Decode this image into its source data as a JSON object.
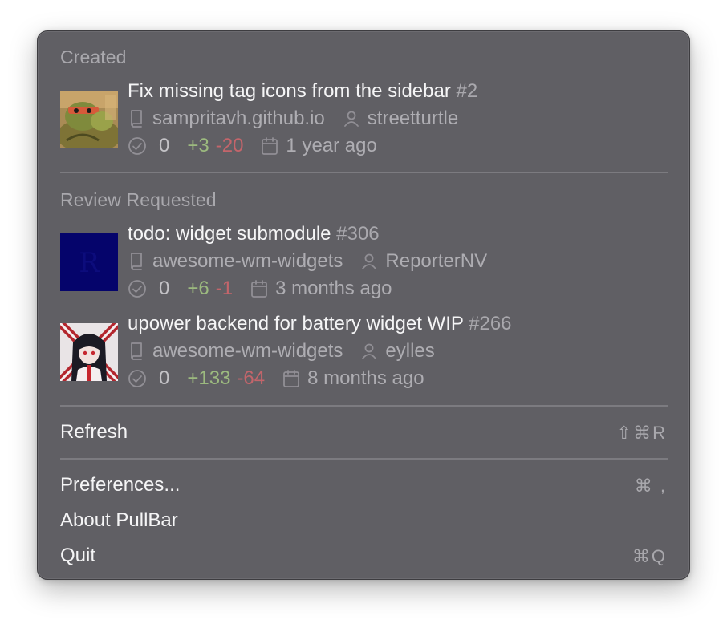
{
  "sections": {
    "created": {
      "title": "Created",
      "items": [
        {
          "title": "Fix missing tag icons from the sidebar",
          "number": "#2",
          "repo": "sampritavh.github.io",
          "author": "streetturtle",
          "approvals": "0",
          "additions": "+3",
          "deletions": "-20",
          "age": "1 year ago",
          "avatar": "turtle-avatar"
        }
      ]
    },
    "review_requested": {
      "title": "Review Requested",
      "items": [
        {
          "title": "todo: widget submodule",
          "number": "#306",
          "repo": "awesome-wm-widgets",
          "author": "ReporterNV",
          "approvals": "0",
          "additions": "+6",
          "deletions": "-1",
          "age": "3 months ago",
          "avatar": "navy-square-avatar"
        },
        {
          "title": "upower backend for battery widget WIP",
          "number": "#266",
          "repo": "awesome-wm-widgets",
          "author": "eylles",
          "approvals": "0",
          "additions": "+133",
          "deletions": "-64",
          "age": "8 months ago",
          "avatar": "anime-character-avatar"
        }
      ]
    }
  },
  "menu": {
    "refresh": {
      "label": "Refresh",
      "shortcut": "⇧⌘R"
    },
    "preferences": {
      "label": "Preferences...",
      "shortcut": "⌘ ,"
    },
    "about": {
      "label": "About PullBar"
    },
    "quit": {
      "label": "Quit",
      "shortcut": "⌘Q"
    }
  },
  "icons": {
    "repo": "repo-icon",
    "author": "person-icon",
    "approvals": "check-circle-icon",
    "age": "calendar-icon"
  },
  "colors": {
    "menu_background": "#605f64",
    "primary_text": "#f5f5f6",
    "secondary_text": "#a9a8ad",
    "additions": "#9cba7f",
    "deletions": "#c4656b",
    "separator": "#7c7b80"
  }
}
